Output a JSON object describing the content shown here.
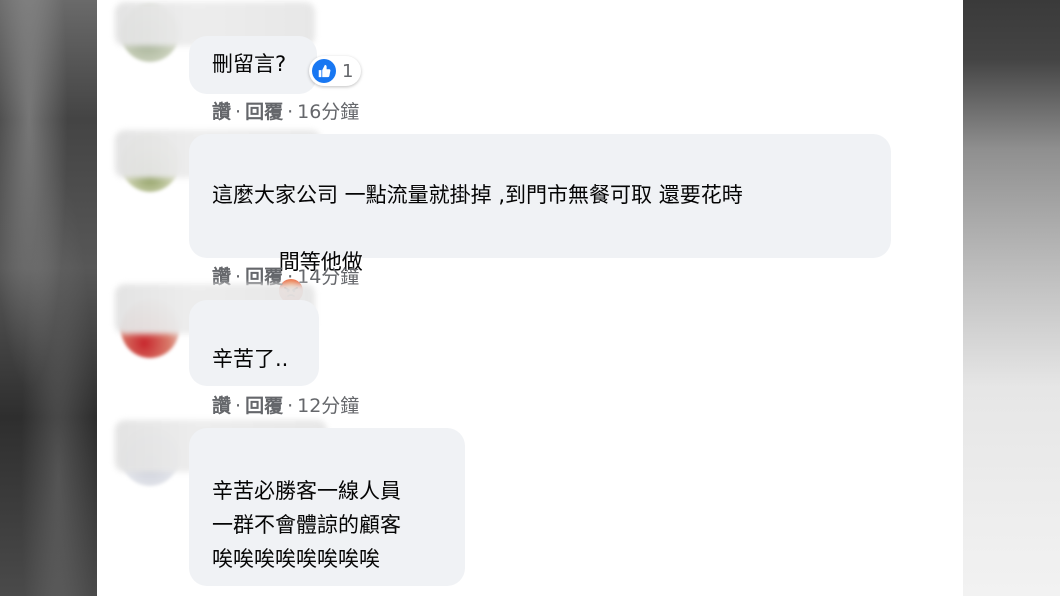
{
  "comments": [
    {
      "text": "刪留言?",
      "reaction": {
        "icon": "like-icon",
        "count": "1"
      },
      "actions": {
        "like": "讚",
        "reply": "回覆",
        "time": "16分鐘"
      }
    },
    {
      "text_line1": "這麼大家公司 一點流量就掛掉 ,到門市無餐可取 還要花時",
      "text_line2": "間等他做",
      "emoji": "angry-face-icon",
      "actions": {
        "like": "讚",
        "reply": "回覆",
        "time": "14分鐘"
      }
    },
    {
      "text": "辛苦了..",
      "actions": {
        "like": "讚",
        "reply": "回覆",
        "time": "12分鐘"
      }
    },
    {
      "text": "辛苦必勝客一線人員\n一群不會體諒的顧客\n唉唉唉唉唉唉唉唉"
    }
  ],
  "colors": {
    "bubble": "#f0f2f5",
    "text": "#050505",
    "meta": "#65676b",
    "like_blue": "#1877f2"
  }
}
